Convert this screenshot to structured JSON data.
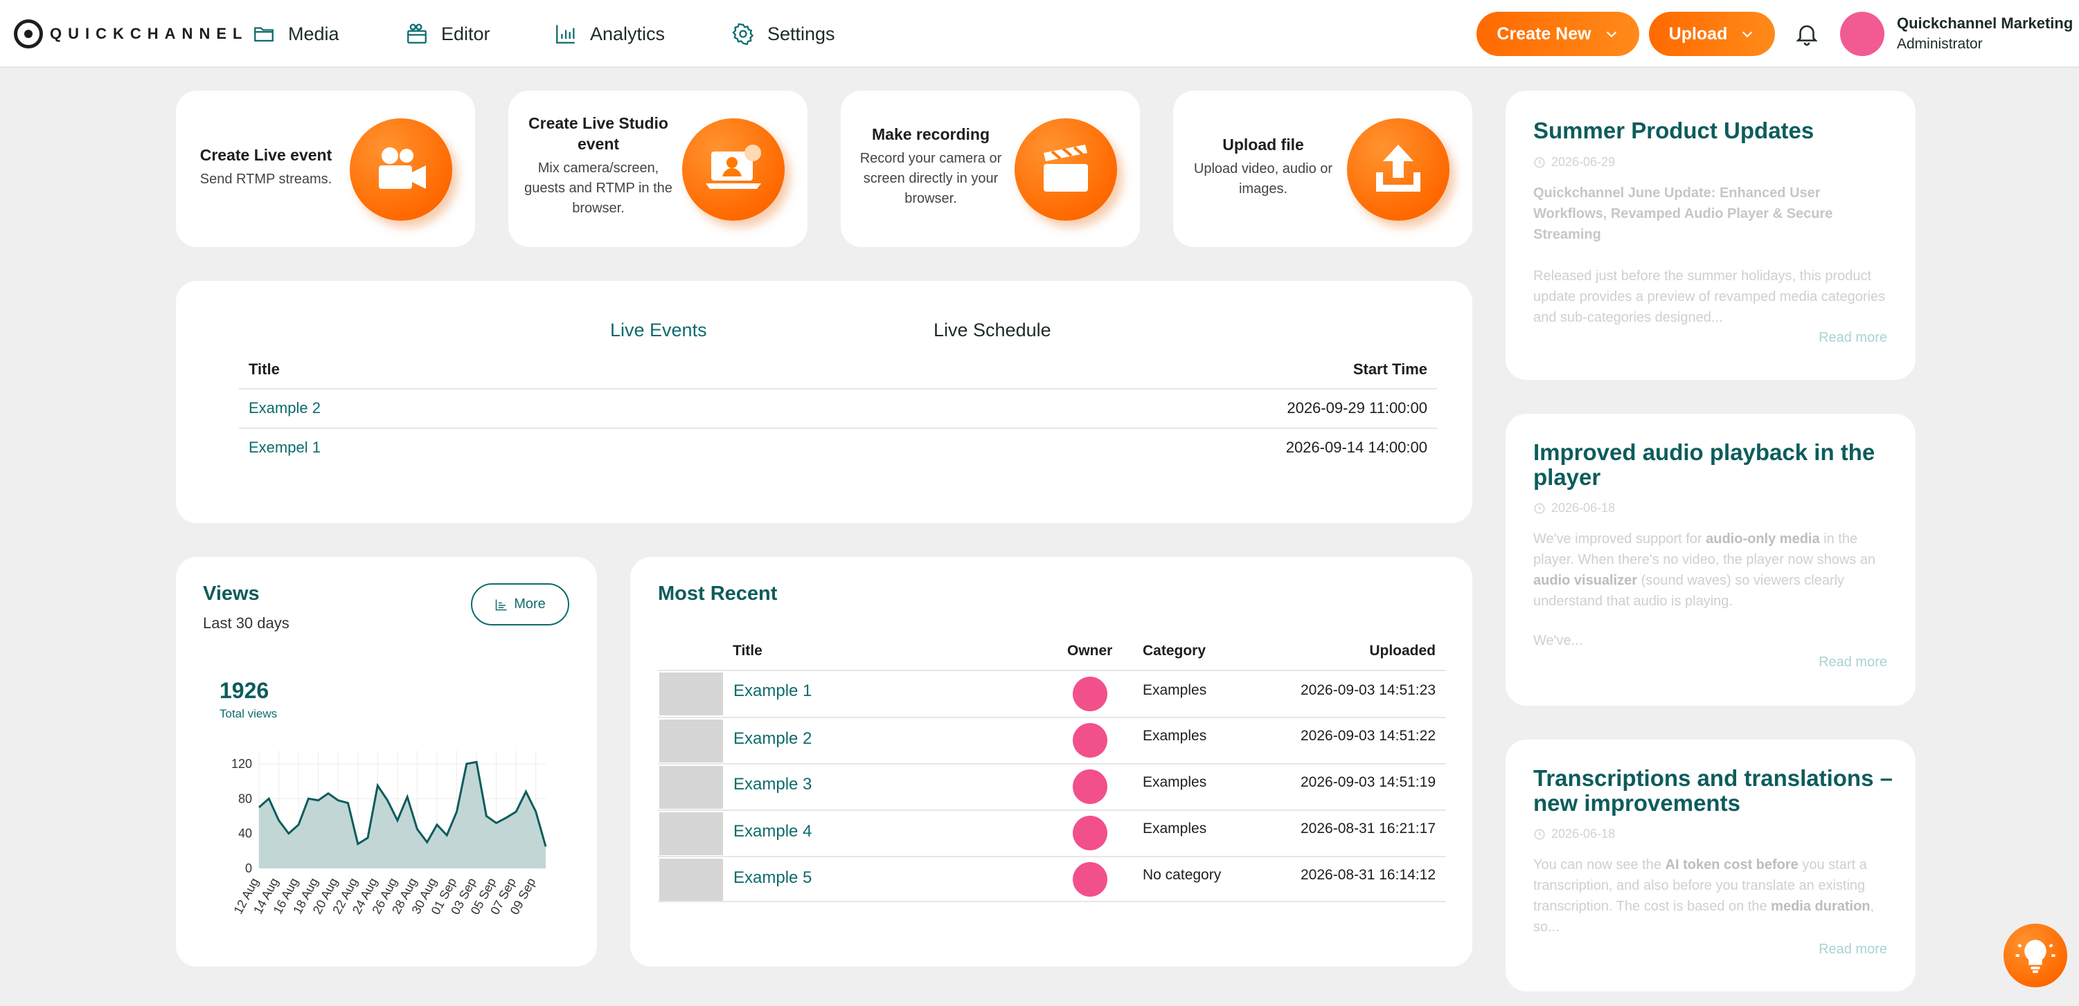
{
  "brand": {
    "name": "QUICKCHANNEL"
  },
  "nav": [
    {
      "label": "Media",
      "icon": "folder-icon"
    },
    {
      "label": "Editor",
      "icon": "editor-icon"
    },
    {
      "label": "Analytics",
      "icon": "bar-chart-icon"
    },
    {
      "label": "Settings",
      "icon": "gear-icon"
    }
  ],
  "header": {
    "create_new_label": "Create New",
    "upload_label": "Upload",
    "user_name": "Quickchannel Marketing",
    "user_role": "Administrator"
  },
  "quick_actions": [
    {
      "title": "Create Live event",
      "desc": "Send RTMP streams.",
      "icon": "video-camera-icon"
    },
    {
      "title": "Create Live Studio event",
      "desc": "Mix camera/screen, guests and RTMP in the browser.",
      "icon": "studio-laptop-icon"
    },
    {
      "title": "Make recording",
      "desc": "Record your camera or screen directly in your browser.",
      "icon": "clapperboard-icon"
    },
    {
      "title": "Upload file",
      "desc": "Upload video, audio or images.",
      "icon": "upload-icon"
    }
  ],
  "live": {
    "tabs": [
      "Live Events",
      "Live Schedule"
    ],
    "active_tab": "Live Events",
    "columns": [
      "Title",
      "Start Time"
    ],
    "rows": [
      {
        "title": "Example 2",
        "start": "2026-09-29 11:00:00"
      },
      {
        "title": "Exempel 1",
        "start": "2026-09-14 14:00:00"
      }
    ]
  },
  "views": {
    "title": "Views",
    "subtitle": "Last 30 days",
    "more_label": "More",
    "total": "1926",
    "total_label": "Total views"
  },
  "chart_data": {
    "type": "area",
    "x": [
      "12 Aug",
      "13 Aug",
      "14 Aug",
      "15 Aug",
      "16 Aug",
      "17 Aug",
      "18 Aug",
      "19 Aug",
      "20 Aug",
      "21 Aug",
      "22 Aug",
      "23 Aug",
      "24 Aug",
      "25 Aug",
      "26 Aug",
      "27 Aug",
      "28 Aug",
      "29 Aug",
      "30 Aug",
      "31 Aug",
      "01 Sep",
      "02 Sep",
      "03 Sep",
      "04 Sep",
      "05 Sep",
      "06 Sep",
      "07 Sep",
      "08 Sep",
      "09 Sep",
      "10 Sep"
    ],
    "tick_labels": [
      "12 Aug",
      "14 Aug",
      "16 Aug",
      "18 Aug",
      "20 Aug",
      "22 Aug",
      "24 Aug",
      "26 Aug",
      "28 Aug",
      "30 Aug",
      "01 Sep",
      "03 Sep",
      "05 Sep",
      "07 Sep",
      "09 Sep"
    ],
    "series": [
      {
        "values": [
          70,
          80,
          55,
          40,
          50,
          80,
          78,
          86,
          78,
          75,
          28,
          35,
          95,
          78,
          55,
          82,
          45,
          30,
          50,
          38,
          65,
          120,
          122,
          60,
          52,
          58,
          65,
          88,
          65,
          25
        ]
      }
    ],
    "yticks": [
      0,
      40,
      80,
      120
    ],
    "ylim": [
      0,
      135
    ],
    "grid": true,
    "colors": {
      "line": "#0d5c5c",
      "fill": "#c2d6d6"
    }
  },
  "recent": {
    "title": "Most Recent",
    "columns": [
      "Title",
      "Owner",
      "Category",
      "Uploaded"
    ],
    "rows": [
      {
        "title": "Example 1",
        "category": "Examples",
        "uploaded": "2026-09-03 14:51:23"
      },
      {
        "title": "Example 2",
        "category": "Examples",
        "uploaded": "2026-09-03 14:51:22"
      },
      {
        "title": "Example 3",
        "category": "Examples",
        "uploaded": "2026-09-03 14:51:19"
      },
      {
        "title": "Example 4",
        "category": "Examples",
        "uploaded": "2026-08-31 16:21:17"
      },
      {
        "title": "Example 5",
        "category": "No category",
        "uploaded": "2026-08-31 16:14:12"
      }
    ]
  },
  "news": [
    {
      "title": "Summer Product Updates",
      "date": "2026-06-29",
      "subtitle": "Quickchannel June Update: Enhanced User Workflows, Revamped Audio Player & Secure Streaming",
      "excerpt": "Released just before the summer holidays, this product update provides a preview of revamped media categories and sub-categories designed...",
      "read_more": "Read more"
    },
    {
      "title": "Improved audio playback in the player",
      "date": "2026-06-18",
      "excerpt_parts": [
        "We've improved support for ",
        "audio-only media",
        " in the player. When there's no video, the player now shows an ",
        "audio visualizer",
        " (sound waves) so viewers clearly understand that audio is playing."
      ],
      "excerpt_tail": "We've...",
      "read_more": "Read more"
    },
    {
      "title": "Transcriptions and translations – new improvements",
      "date": "2026-06-18",
      "excerpt_parts": [
        "You can now see the ",
        "AI token cost before",
        " you start a transcription, and also before you translate an existing transcription. The cost is based on the ",
        "media duration",
        ", so..."
      ],
      "read_more": "Read more"
    }
  ],
  "colors": {
    "accent": "#ff7a00",
    "teal": "#0d5c5c",
    "avatar": "#f25a92"
  }
}
